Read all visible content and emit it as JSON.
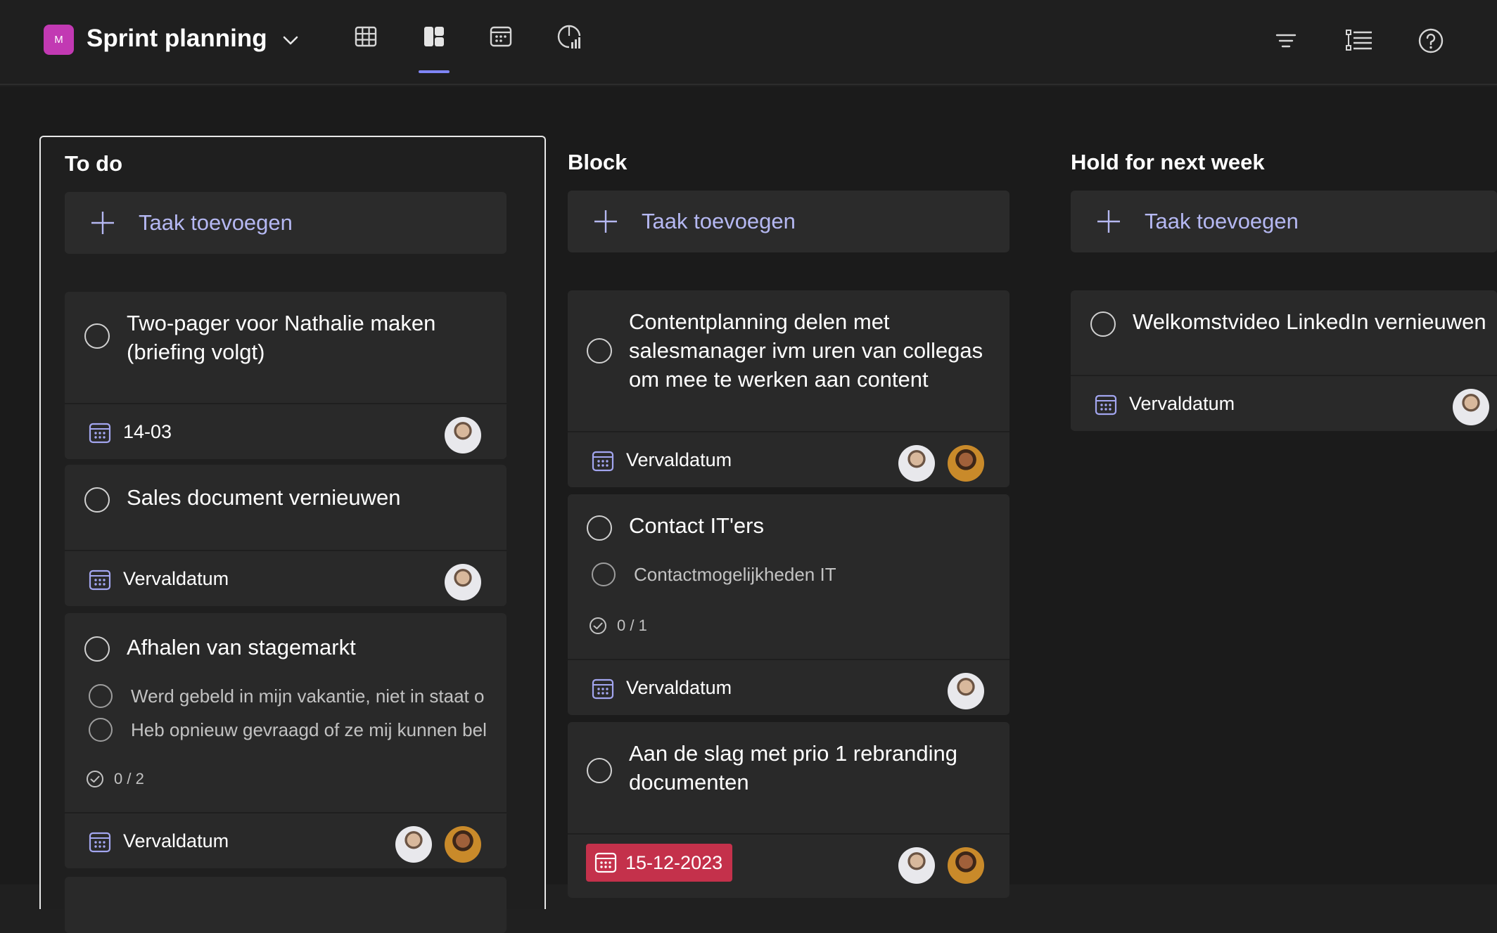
{
  "header": {
    "plan_avatar_letter": "M",
    "plan_title": "Sprint planning",
    "views": [
      {
        "name": "grid-view",
        "icon": "grid-icon",
        "active": false
      },
      {
        "name": "board-view",
        "icon": "board-icon",
        "active": true
      },
      {
        "name": "schedule-view",
        "icon": "calendar-icon",
        "active": false
      },
      {
        "name": "charts-view",
        "icon": "chart-icon",
        "active": false
      }
    ],
    "right_icons": [
      "filter-icon",
      "group-by-icon",
      "help-icon"
    ]
  },
  "columns": [
    {
      "title": "To do",
      "add_task_label": "Taak toevoegen",
      "cards": [
        {
          "title_lines": [
            "Two-pager voor Nathalie maken",
            "(briefing volgt)"
          ],
          "due": "14-03",
          "assignees": [
            "avatar-1"
          ]
        },
        {
          "title_lines": [
            "Sales document vernieuwen"
          ],
          "due": "Vervaldatum",
          "assignees": [
            "avatar-1"
          ]
        },
        {
          "title_lines": [
            "Afhalen van stagemarkt"
          ],
          "checklist": [
            "Werd gebeld in mijn vakantie, niet in staat o",
            "Heb opnieuw gevraagd of ze mij kunnen bel"
          ],
          "progress": "0 / 2",
          "due": "Vervaldatum",
          "assignees": [
            "avatar-1",
            "avatar-2"
          ]
        }
      ]
    },
    {
      "title": "Block",
      "add_task_label": "Taak toevoegen",
      "cards": [
        {
          "title_lines": [
            "Contentplanning delen met",
            "salesmanager ivm uren van collegas",
            "om mee te werken aan content"
          ],
          "due": "Vervaldatum",
          "assignees": [
            "avatar-1",
            "avatar-2"
          ]
        },
        {
          "title_lines": [
            "Contact IT'ers"
          ],
          "checklist": [
            "Contactmogelijkheden IT"
          ],
          "progress": "0 / 1",
          "due": "Vervaldatum",
          "assignees": [
            "avatar-1"
          ]
        },
        {
          "title_lines": [
            "Aan de slag met prio 1 rebranding",
            "documenten"
          ],
          "due": "15-12-2023",
          "due_overdue": true,
          "assignees": [
            "avatar-1",
            "avatar-2"
          ]
        }
      ]
    },
    {
      "title": "Hold for next week",
      "add_task_label": "Taak toevoegen",
      "cards": [
        {
          "title_lines": [
            "Welkomstvideo LinkedIn vernieuwen"
          ],
          "due": "Vervaldatum",
          "assignees": [
            "avatar-1"
          ]
        }
      ]
    }
  ],
  "colors": {
    "accent": "#7f85f5",
    "plan_avatar": "#c239b3",
    "overdue": "#c4314b",
    "add_task_text": "#b5b8f2"
  }
}
